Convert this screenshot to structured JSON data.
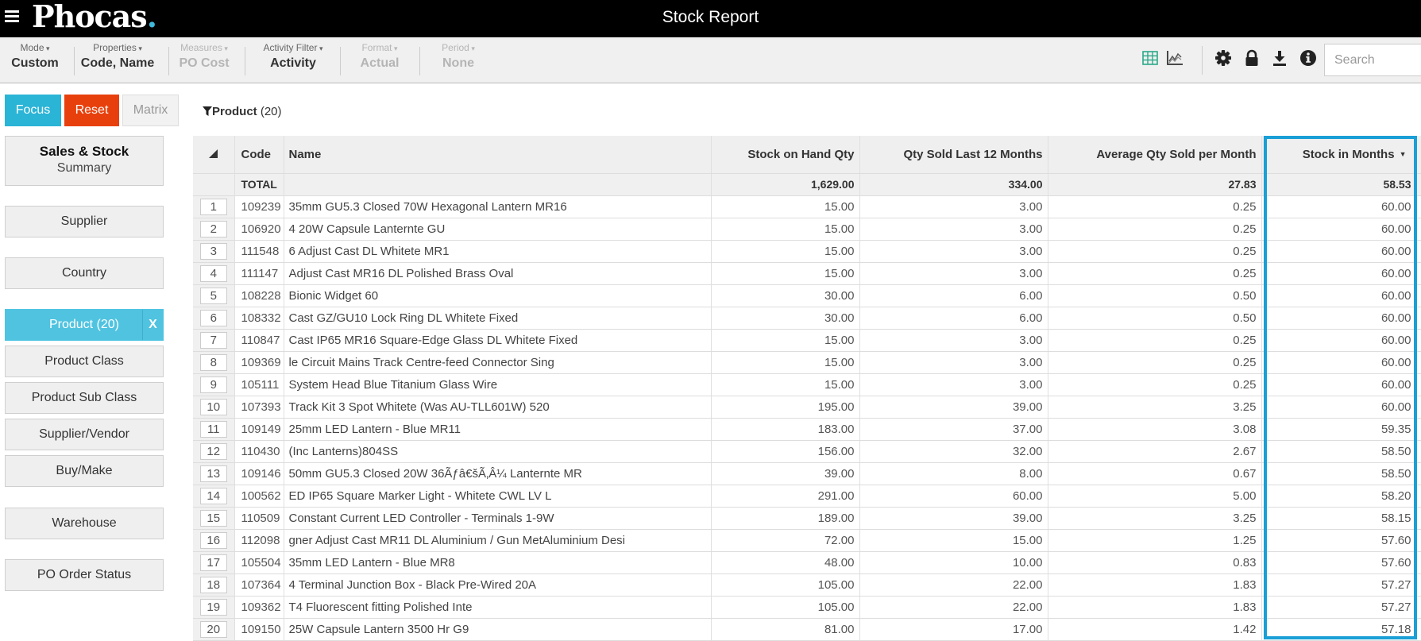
{
  "app": {
    "brand": "Phocas",
    "brand_dot": ".",
    "title": "Stock Report",
    "accent_color": "#2ab4d6",
    "reset_color": "#e8400c",
    "highlight_color": "#1a9fd6"
  },
  "toolbar": {
    "groups": [
      {
        "label": "Mode",
        "value": "Custom",
        "enabled": true
      },
      {
        "label": "Properties",
        "value": "Code, Name",
        "enabled": true
      },
      {
        "label": "Measures",
        "value": "PO Cost",
        "enabled": false
      },
      {
        "label": "Activity Filter",
        "value": "Activity",
        "enabled": true
      },
      {
        "label": "Format",
        "value": "Actual",
        "enabled": false
      },
      {
        "label": "Period",
        "value": "None",
        "enabled": false
      }
    ],
    "caret": "▾",
    "icons": [
      "grid-view-icon",
      "chart-view-icon",
      "gear-icon",
      "lock-icon",
      "download-icon",
      "info-icon"
    ],
    "search_placeholder": "Search"
  },
  "actions": {
    "focus": "Focus",
    "reset": "Reset",
    "matrix": "Matrix"
  },
  "sidebar": {
    "summary_title": "Sales & Stock",
    "summary_subtitle": "Summary",
    "items": [
      {
        "label": "Supplier",
        "active": false
      },
      {
        "label": "Country",
        "active": false
      },
      {
        "label": "Product (20)",
        "active": true,
        "close": "X"
      },
      {
        "label": "Product Class",
        "active": false
      },
      {
        "label": "Product Sub Class",
        "active": false
      },
      {
        "label": "Supplier/Vendor",
        "active": false
      },
      {
        "label": "Buy/Make",
        "active": false
      },
      {
        "label": "Warehouse",
        "active": false
      },
      {
        "label": "PO Order Status",
        "active": false
      }
    ]
  },
  "filter": {
    "dimension": "Product",
    "count": "(20)"
  },
  "table": {
    "columns": [
      "Code",
      "Name",
      "Stock on Hand Qty",
      "Qty Sold Last 12 Months",
      "Average Qty Sold per Month",
      "Stock in Months"
    ],
    "sorted_column": "Stock in Months",
    "total": {
      "label": "TOTAL",
      "stock_on_hand": "1,629.00",
      "qty_sold_12m": "334.00",
      "avg_per_month": "27.83",
      "stock_in_months": "58.53"
    },
    "rows": [
      {
        "n": "1",
        "code": "109239",
        "name": "35mm GU5.3 Closed 70W Hexagonal Lantern MR16",
        "soh": "15.00",
        "sold": "3.00",
        "avg": "0.25",
        "months": "60.00"
      },
      {
        "n": "2",
        "code": "106920",
        "name": "4 20W Capsule Lanternte GU",
        "soh": "15.00",
        "sold": "3.00",
        "avg": "0.25",
        "months": "60.00"
      },
      {
        "n": "3",
        "code": "111548",
        "name": "6 Adjust Cast DL Whitete MR1",
        "soh": "15.00",
        "sold": "3.00",
        "avg": "0.25",
        "months": "60.00"
      },
      {
        "n": "4",
        "code": "111147",
        "name": "Adjust Cast MR16 DL Polished Brass Oval",
        "soh": "15.00",
        "sold": "3.00",
        "avg": "0.25",
        "months": "60.00"
      },
      {
        "n": "5",
        "code": "108228",
        "name": "Bionic Widget 60",
        "soh": "30.00",
        "sold": "6.00",
        "avg": "0.50",
        "months": "60.00"
      },
      {
        "n": "6",
        "code": "108332",
        "name": "Cast GZ/GU10 Lock Ring DL Whitete Fixed",
        "soh": "30.00",
        "sold": "6.00",
        "avg": "0.50",
        "months": "60.00"
      },
      {
        "n": "7",
        "code": "110847",
        "name": "Cast IP65 MR16 Square-Edge Glass DL Whitete Fixed",
        "soh": "15.00",
        "sold": "3.00",
        "avg": "0.25",
        "months": "60.00"
      },
      {
        "n": "8",
        "code": "109369",
        "name": "le Circuit Mains Track Centre-feed Connector Sing",
        "soh": "15.00",
        "sold": "3.00",
        "avg": "0.25",
        "months": "60.00"
      },
      {
        "n": "9",
        "code": "105111",
        "name": "System Head Blue Titanium Glass Wire",
        "soh": "15.00",
        "sold": "3.00",
        "avg": "0.25",
        "months": "60.00"
      },
      {
        "n": "10",
        "code": "107393",
        "name": "Track Kit 3 Spot Whitete (Was AU-TLL601W) 520",
        "soh": "195.00",
        "sold": "39.00",
        "avg": "3.25",
        "months": "60.00"
      },
      {
        "n": "11",
        "code": "109149",
        "name": "25mm LED Lantern - Blue MR11",
        "soh": "183.00",
        "sold": "37.00",
        "avg": "3.08",
        "months": "59.35"
      },
      {
        "n": "12",
        "code": "110430",
        "name": "(Inc Lanterns)804SS",
        "soh": "156.00",
        "sold": "32.00",
        "avg": "2.67",
        "months": "58.50"
      },
      {
        "n": "13",
        "code": "109146",
        "name": "50mm GU5.3 Closed 20W 36Ãƒâ€šÃ‚Â¼ Lanternte MR",
        "soh": "39.00",
        "sold": "8.00",
        "avg": "0.67",
        "months": "58.50"
      },
      {
        "n": "14",
        "code": "100562",
        "name": "ED IP65 Square Marker Light - Whitete CWL LV L",
        "soh": "291.00",
        "sold": "60.00",
        "avg": "5.00",
        "months": "58.20"
      },
      {
        "n": "15",
        "code": "110509",
        "name": "Constant Current LED Controller - Terminals 1-9W",
        "soh": "189.00",
        "sold": "39.00",
        "avg": "3.25",
        "months": "58.15"
      },
      {
        "n": "16",
        "code": "112098",
        "name": "gner Adjust Cast MR11 DL Aluminium / Gun MetAluminium Desi",
        "soh": "72.00",
        "sold": "15.00",
        "avg": "1.25",
        "months": "57.60"
      },
      {
        "n": "17",
        "code": "105504",
        "name": "35mm LED Lantern - Blue MR8",
        "soh": "48.00",
        "sold": "10.00",
        "avg": "0.83",
        "months": "57.60"
      },
      {
        "n": "18",
        "code": "107364",
        "name": "4 Terminal Junction Box - Black Pre-Wired 20A",
        "soh": "105.00",
        "sold": "22.00",
        "avg": "1.83",
        "months": "57.27"
      },
      {
        "n": "19",
        "code": "109362",
        "name": "T4 Fluorescent fitting Polished Inte",
        "soh": "105.00",
        "sold": "22.00",
        "avg": "1.83",
        "months": "57.27"
      },
      {
        "n": "20",
        "code": "109150",
        "name": "25W Capsule Lantern 3500 Hr G9",
        "soh": "81.00",
        "sold": "17.00",
        "avg": "1.42",
        "months": "57.18"
      }
    ]
  }
}
